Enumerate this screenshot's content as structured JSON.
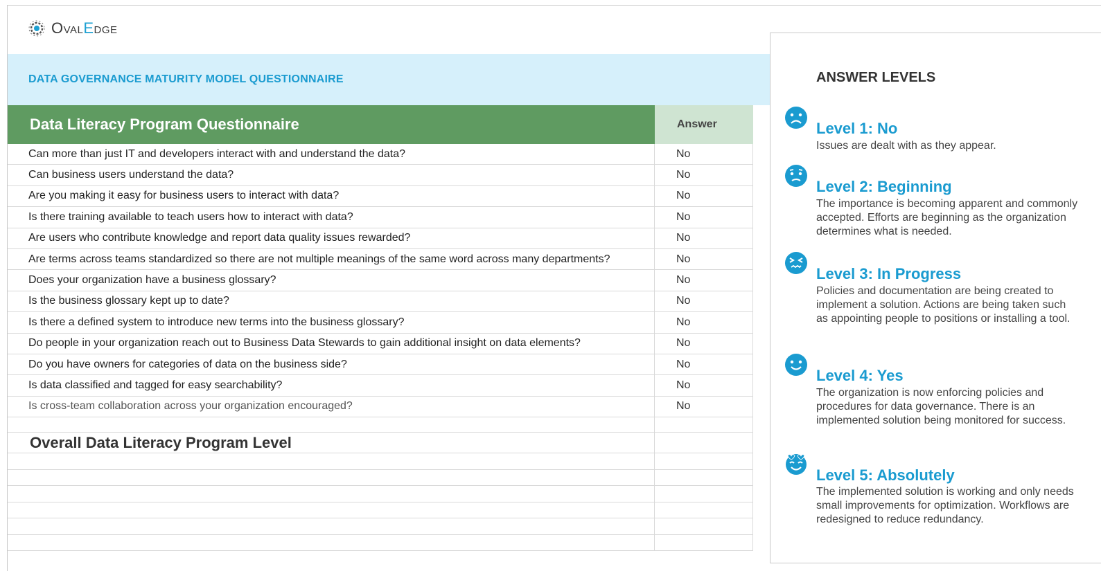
{
  "logo": {
    "text_part1": "Oval",
    "text_part2": "E",
    "text_part3": "dge"
  },
  "banner": {
    "title": "DATA GOVERNANCE MATURITY MODEL QUESTIONNAIRE"
  },
  "table": {
    "header_question": "Data Literacy Program Questionnaire",
    "header_answer": "Answer",
    "rows": [
      {
        "question": "Can more than just IT and developers interact with and understand the data?",
        "answer": "No"
      },
      {
        "question": "Can business users understand the data?",
        "answer": "No"
      },
      {
        "question": "Are you making it easy for business users to interact with data?",
        "answer": "No"
      },
      {
        "question": "Is there training available to teach users how to interact with data?",
        "answer": "No"
      },
      {
        "question": "Are users who contribute knowledge and report data quality issues rewarded?",
        "answer": "No"
      },
      {
        "question": "Are terms across teams standardized so there are not multiple meanings of the same word across many departments?",
        "answer": "No"
      },
      {
        "question": "Does your organization have a business glossary?",
        "answer": "No"
      },
      {
        "question": "Is the business glossary kept up to date?",
        "answer": "No"
      },
      {
        "question": "Is there a defined system to introduce new terms into the business glossary?",
        "answer": "No"
      },
      {
        "question": "Do people in your organization reach out to Business Data Stewards to gain additional insight on data elements?",
        "answer": "No"
      },
      {
        "question": "Do you have owners for categories of data on the business side?",
        "answer": "No"
      },
      {
        "question": "Is data classified and tagged for easy searchability?",
        "answer": "No"
      },
      {
        "question": "Is cross-team collaboration across your organization encouraged?",
        "answer": "No"
      }
    ],
    "overall_label": "Overall Data Literacy Program Level"
  },
  "answer_levels": {
    "title": "ANSWER LEVELS",
    "levels": [
      {
        "title": "Level 1: No",
        "description": "Issues are dealt with as they appear.",
        "icon": "sad-face-icon"
      },
      {
        "title": "Level 2: Beginning",
        "description": "The importance is becoming apparent and commonly accepted. Efforts are beginning as the organization determines what is needed.",
        "icon": "worried-face-icon"
      },
      {
        "title": "Level 3: In Progress",
        "description": "Policies and documentation are being created to implement a solution. Actions are being taken such as appointing people to positions or installing a tool.",
        "icon": "squint-face-icon"
      },
      {
        "title": "Level 4: Yes",
        "description": "The organization is now enforcing policies and procedures for data governance. There is an implemented solution being monitored for success.",
        "icon": "smile-face-icon"
      },
      {
        "title": "Level 5: Absolutely",
        "description": "The implemented solution is working and only needs small improvements for optimization. Workflows are redesigned to reduce redundancy.",
        "icon": "love-face-icon"
      }
    ],
    "accent_color": "#1a9bd0"
  }
}
